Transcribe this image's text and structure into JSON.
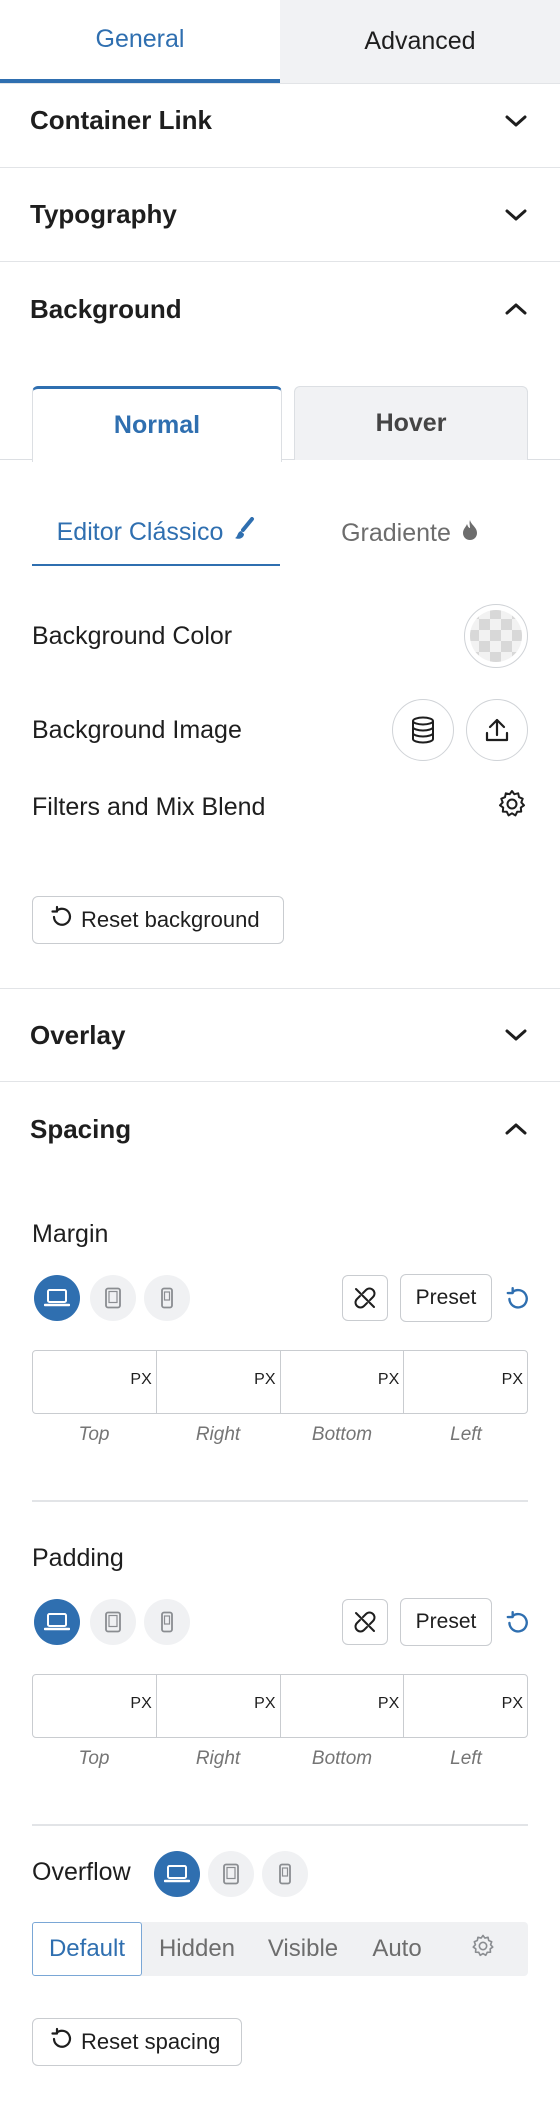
{
  "tabs": {
    "general": "General",
    "advanced": "Advanced"
  },
  "sections": {
    "container_link": "Container Link",
    "typography": "Typography",
    "background": "Background",
    "overlay": "Overlay",
    "spacing": "Spacing"
  },
  "background": {
    "state_tabs": {
      "normal": "Normal",
      "hover": "Hover"
    },
    "mode_tabs": {
      "classic": "Editor Clássico",
      "gradient": "Gradiente"
    },
    "color_label": "Background Color",
    "image_label": "Background Image",
    "filters_label": "Filters and Mix Blend",
    "reset_label": "Reset background"
  },
  "spacing": {
    "margin": {
      "label": "Margin",
      "preset": "Preset",
      "unit": "PX",
      "fields": [
        "Top",
        "Right",
        "Bottom",
        "Left"
      ]
    },
    "padding": {
      "label": "Padding",
      "preset": "Preset",
      "unit": "PX",
      "fields": [
        "Top",
        "Right",
        "Bottom",
        "Left"
      ]
    },
    "overflow": {
      "label": "Overflow",
      "options": [
        "Default",
        "Hidden",
        "Visible",
        "Auto"
      ],
      "selected": "Default"
    },
    "reset_label": "Reset spacing"
  },
  "colors": {
    "accent": "#2f6fb0",
    "border": "#c9ccd0",
    "muted": "#757575"
  },
  "icons": [
    "chevron-down-icon",
    "chevron-up-icon",
    "brush-icon",
    "flame-icon",
    "checker-swatch-icon",
    "database-icon",
    "upload-icon",
    "gear-icon",
    "undo-icon",
    "laptop-icon",
    "tablet-icon",
    "mobile-icon",
    "unlink-icon"
  ]
}
